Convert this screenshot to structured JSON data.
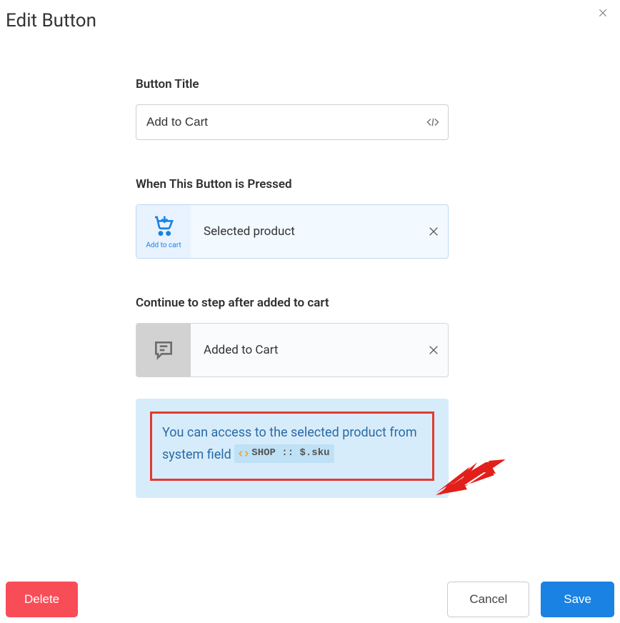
{
  "modal": {
    "title": "Edit Button"
  },
  "form": {
    "title_label": "Button Title",
    "title_value": "Add to Cart"
  },
  "pressed": {
    "label": "When This Button is Pressed",
    "action_caption": "Add to cart",
    "action_text": "Selected product"
  },
  "continue": {
    "label": "Continue to step after added to cart",
    "step_text": "Added to Cart"
  },
  "info": {
    "text_prefix": "You can access to the selected product from system field ",
    "token_text": "SHOP :: $.sku"
  },
  "footer": {
    "delete_label": "Delete",
    "cancel_label": "Cancel",
    "save_label": "Save"
  }
}
